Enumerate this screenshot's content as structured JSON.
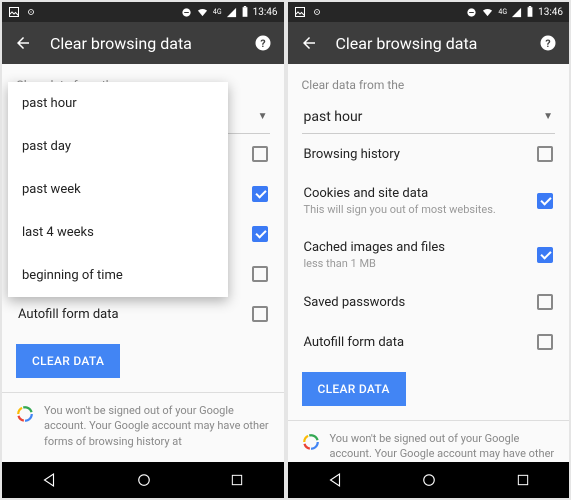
{
  "status": {
    "time": "13:46",
    "network": "4G"
  },
  "appbar": {
    "title": "Clear browsing data"
  },
  "label": "Clear data from the",
  "dropdown": {
    "selected": "past hour"
  },
  "dropdown_options": [
    "past hour",
    "past day",
    "past week",
    "last 4 weeks",
    "beginning of time"
  ],
  "options": [
    {
      "label": "Browsing history",
      "sub": "",
      "checked": false
    },
    {
      "label": "Cookies and site data",
      "sub": "This will sign you out of most websites.",
      "checked": true
    },
    {
      "label": "Cached images and files",
      "sub": "less than 1 MB",
      "checked": true
    },
    {
      "label": "Saved passwords",
      "sub": "",
      "checked": false
    },
    {
      "label": "Autofill form data",
      "sub": "",
      "checked": false
    }
  ],
  "button": "CLEAR DATA",
  "footer": "You won't be signed out of your Google account. Your Google account may have other forms of browsing history at"
}
